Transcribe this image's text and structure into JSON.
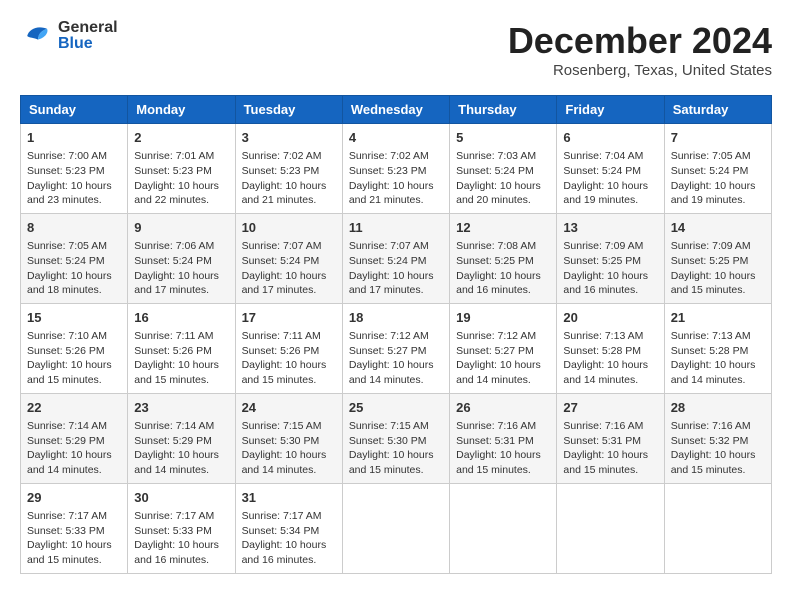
{
  "header": {
    "logo_general": "General",
    "logo_blue": "Blue",
    "month_title": "December 2024",
    "location": "Rosenberg, Texas, United States"
  },
  "calendar": {
    "days_of_week": [
      "Sunday",
      "Monday",
      "Tuesday",
      "Wednesday",
      "Thursday",
      "Friday",
      "Saturday"
    ],
    "weeks": [
      [
        {
          "day": "1",
          "info": "Sunrise: 7:00 AM\nSunset: 5:23 PM\nDaylight: 10 hours\nand 23 minutes."
        },
        {
          "day": "2",
          "info": "Sunrise: 7:01 AM\nSunset: 5:23 PM\nDaylight: 10 hours\nand 22 minutes."
        },
        {
          "day": "3",
          "info": "Sunrise: 7:02 AM\nSunset: 5:23 PM\nDaylight: 10 hours\nand 21 minutes."
        },
        {
          "day": "4",
          "info": "Sunrise: 7:02 AM\nSunset: 5:23 PM\nDaylight: 10 hours\nand 21 minutes."
        },
        {
          "day": "5",
          "info": "Sunrise: 7:03 AM\nSunset: 5:24 PM\nDaylight: 10 hours\nand 20 minutes."
        },
        {
          "day": "6",
          "info": "Sunrise: 7:04 AM\nSunset: 5:24 PM\nDaylight: 10 hours\nand 19 minutes."
        },
        {
          "day": "7",
          "info": "Sunrise: 7:05 AM\nSunset: 5:24 PM\nDaylight: 10 hours\nand 19 minutes."
        }
      ],
      [
        {
          "day": "8",
          "info": "Sunrise: 7:05 AM\nSunset: 5:24 PM\nDaylight: 10 hours\nand 18 minutes."
        },
        {
          "day": "9",
          "info": "Sunrise: 7:06 AM\nSunset: 5:24 PM\nDaylight: 10 hours\nand 17 minutes."
        },
        {
          "day": "10",
          "info": "Sunrise: 7:07 AM\nSunset: 5:24 PM\nDaylight: 10 hours\nand 17 minutes."
        },
        {
          "day": "11",
          "info": "Sunrise: 7:07 AM\nSunset: 5:24 PM\nDaylight: 10 hours\nand 17 minutes."
        },
        {
          "day": "12",
          "info": "Sunrise: 7:08 AM\nSunset: 5:25 PM\nDaylight: 10 hours\nand 16 minutes."
        },
        {
          "day": "13",
          "info": "Sunrise: 7:09 AM\nSunset: 5:25 PM\nDaylight: 10 hours\nand 16 minutes."
        },
        {
          "day": "14",
          "info": "Sunrise: 7:09 AM\nSunset: 5:25 PM\nDaylight: 10 hours\nand 15 minutes."
        }
      ],
      [
        {
          "day": "15",
          "info": "Sunrise: 7:10 AM\nSunset: 5:26 PM\nDaylight: 10 hours\nand 15 minutes."
        },
        {
          "day": "16",
          "info": "Sunrise: 7:11 AM\nSunset: 5:26 PM\nDaylight: 10 hours\nand 15 minutes."
        },
        {
          "day": "17",
          "info": "Sunrise: 7:11 AM\nSunset: 5:26 PM\nDaylight: 10 hours\nand 15 minutes."
        },
        {
          "day": "18",
          "info": "Sunrise: 7:12 AM\nSunset: 5:27 PM\nDaylight: 10 hours\nand 14 minutes."
        },
        {
          "day": "19",
          "info": "Sunrise: 7:12 AM\nSunset: 5:27 PM\nDaylight: 10 hours\nand 14 minutes."
        },
        {
          "day": "20",
          "info": "Sunrise: 7:13 AM\nSunset: 5:28 PM\nDaylight: 10 hours\nand 14 minutes."
        },
        {
          "day": "21",
          "info": "Sunrise: 7:13 AM\nSunset: 5:28 PM\nDaylight: 10 hours\nand 14 minutes."
        }
      ],
      [
        {
          "day": "22",
          "info": "Sunrise: 7:14 AM\nSunset: 5:29 PM\nDaylight: 10 hours\nand 14 minutes."
        },
        {
          "day": "23",
          "info": "Sunrise: 7:14 AM\nSunset: 5:29 PM\nDaylight: 10 hours\nand 14 minutes."
        },
        {
          "day": "24",
          "info": "Sunrise: 7:15 AM\nSunset: 5:30 PM\nDaylight: 10 hours\nand 14 minutes."
        },
        {
          "day": "25",
          "info": "Sunrise: 7:15 AM\nSunset: 5:30 PM\nDaylight: 10 hours\nand 15 minutes."
        },
        {
          "day": "26",
          "info": "Sunrise: 7:16 AM\nSunset: 5:31 PM\nDaylight: 10 hours\nand 15 minutes."
        },
        {
          "day": "27",
          "info": "Sunrise: 7:16 AM\nSunset: 5:31 PM\nDaylight: 10 hours\nand 15 minutes."
        },
        {
          "day": "28",
          "info": "Sunrise: 7:16 AM\nSunset: 5:32 PM\nDaylight: 10 hours\nand 15 minutes."
        }
      ],
      [
        {
          "day": "29",
          "info": "Sunrise: 7:17 AM\nSunset: 5:33 PM\nDaylight: 10 hours\nand 15 minutes."
        },
        {
          "day": "30",
          "info": "Sunrise: 7:17 AM\nSunset: 5:33 PM\nDaylight: 10 hours\nand 16 minutes."
        },
        {
          "day": "31",
          "info": "Sunrise: 7:17 AM\nSunset: 5:34 PM\nDaylight: 10 hours\nand 16 minutes."
        },
        {
          "day": "",
          "info": ""
        },
        {
          "day": "",
          "info": ""
        },
        {
          "day": "",
          "info": ""
        },
        {
          "day": "",
          "info": ""
        }
      ]
    ]
  }
}
